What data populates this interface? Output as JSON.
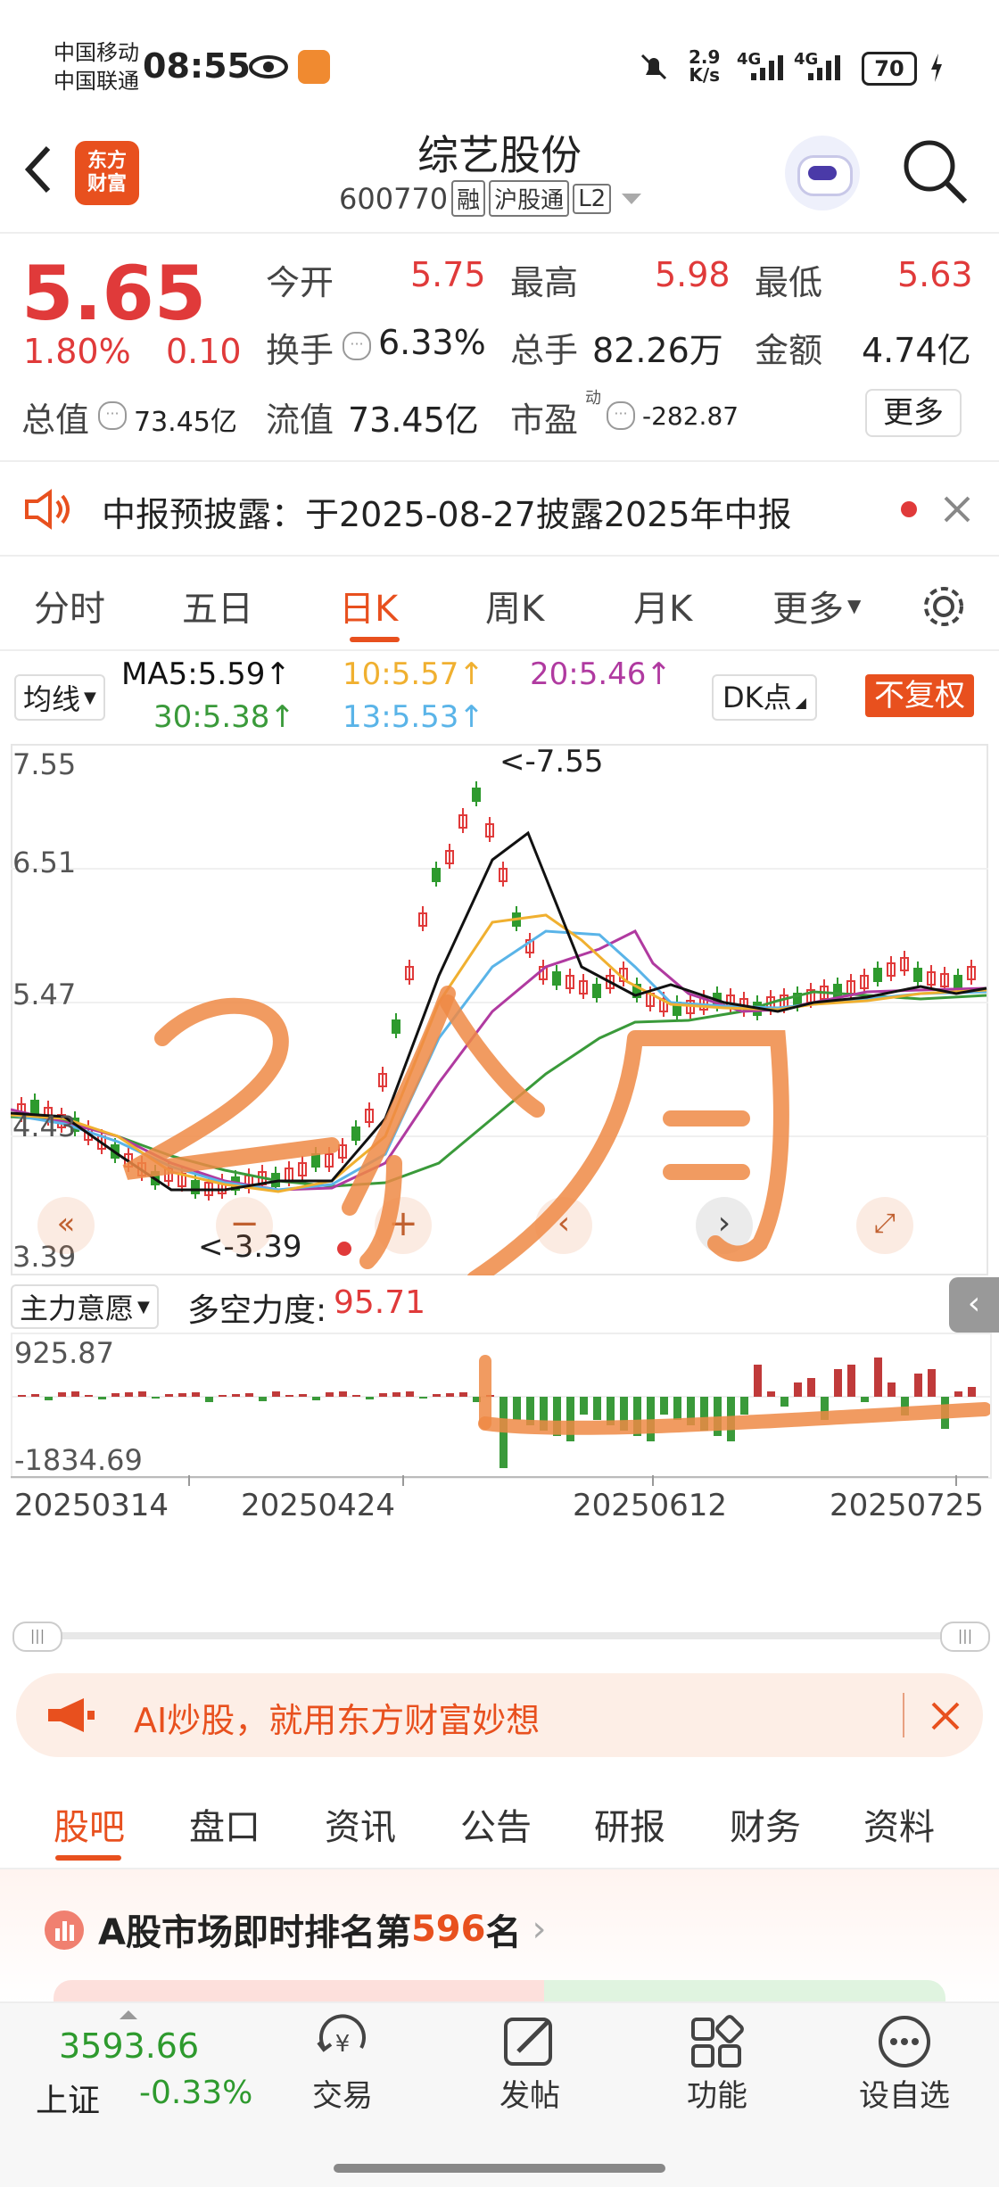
{
  "status": {
    "carrier1": "中国移动",
    "carrier2": "中国联通",
    "time": "08:55",
    "speed_top": "2.9",
    "speed_unit": "K/s",
    "net1": "4G",
    "net2": "4G",
    "battery": "70"
  },
  "header": {
    "logo_line1": "东方",
    "logo_line2": "财富",
    "title": "综艺股份",
    "code": "600770",
    "tags": [
      "融",
      "沪股通",
      "L2"
    ]
  },
  "quote": {
    "price": "5.65",
    "change_pct": "1.80%",
    "change": "0.10",
    "open_label": "今开",
    "open": "5.75",
    "high_label": "最高",
    "high": "5.98",
    "low_label": "最低",
    "low": "5.63",
    "turnover_label": "换手",
    "turnover": "6.33%",
    "volume_label": "总手",
    "volume": "82.26万",
    "amount_label": "金额",
    "amount": "4.74亿",
    "mktcap_label": "总值",
    "mktcap": "73.45亿",
    "float_label": "流值",
    "float": "73.45亿",
    "pe_label": "市盈",
    "pe_sup": "动",
    "pe": "-282.87",
    "more": "更多"
  },
  "notice": {
    "text": "中报预披露：于2025-08-27披露2025年中报"
  },
  "chart_tabs": [
    "分时",
    "五日",
    "日K",
    "周K",
    "月K",
    "更多"
  ],
  "chart_tab_active": 2,
  "ma_bar": {
    "selector": "均线",
    "ma5": "MA5:5.59↑",
    "ma10": "10:5.57↑",
    "ma20": "20:5.46↑",
    "ma30": "30:5.38↑",
    "ma13": "13:5.53↑",
    "dk": "DK点",
    "fq": "不复权"
  },
  "kline": {
    "y_labels": [
      "7.55",
      "6.51",
      "5.47",
      "4.43",
      "3.39"
    ],
    "max_note": "<-7.55",
    "min_note": "<-3.39",
    "handwriting": "2个月"
  },
  "indicator": {
    "selector": "主力意愿",
    "label": "多空力度:",
    "value": "95.71",
    "top": "925.87",
    "bottom": "-1834.69"
  },
  "dates": [
    "20250314",
    "20250424",
    "20250612",
    "20250725"
  ],
  "ad": {
    "text": "AI炒股，就用东方财富妙想"
  },
  "bottom_tabs": [
    "股吧",
    "盘口",
    "资讯",
    "公告",
    "研报",
    "财务",
    "资料"
  ],
  "rank": {
    "prefix": "A股市场即时排名第",
    "num": "596",
    "suffix": "名"
  },
  "nav": {
    "index_value": "3593.66",
    "index_name": "上证",
    "index_change": "-0.33%",
    "items": [
      "交易",
      "发帖",
      "功能",
      "设自选"
    ]
  },
  "colors": {
    "brand": "#e8501e",
    "up": "#e03a3a",
    "down": "#2e9a2e",
    "ma5": "#111111",
    "ma10": "#f0b030",
    "ma20": "#b03aa0",
    "ma30": "#3a9a3a",
    "ma13": "#5ab4e8"
  }
}
